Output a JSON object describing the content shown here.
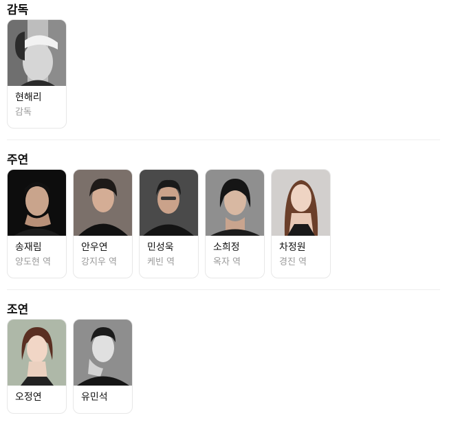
{
  "sections": [
    {
      "title": "감독",
      "people": [
        {
          "name": "현해리",
          "role": "감독",
          "photo_tone": "#7a7a7a"
        }
      ]
    },
    {
      "title": "주연",
      "people": [
        {
          "name": "송재림",
          "role": "양도현 역",
          "photo_tone": "#1a1a1a"
        },
        {
          "name": "안우연",
          "role": "강지우 역",
          "photo_tone": "#8a7f78"
        },
        {
          "name": "민성욱",
          "role": "케빈 역",
          "photo_tone": "#5b5b5b"
        },
        {
          "name": "소희정",
          "role": "옥자 역",
          "photo_tone": "#9a9a9a"
        },
        {
          "name": "차정원",
          "role": "경진 역",
          "photo_tone": "#c9c6c4"
        }
      ]
    },
    {
      "title": "조연",
      "people": [
        {
          "name": "오정연",
          "role": "",
          "photo_tone": "#b9c2b4"
        },
        {
          "name": "유민석",
          "role": "",
          "photo_tone": "#9c9c9c"
        }
      ]
    }
  ]
}
